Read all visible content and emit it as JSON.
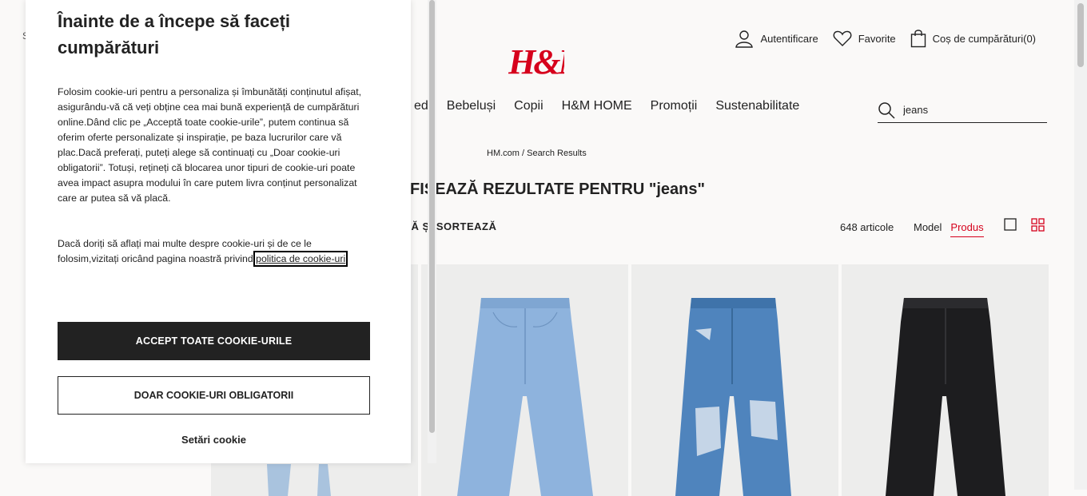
{
  "header": {
    "topleft_text": "S",
    "logo_text": "H&M",
    "login_label": "Autentificare",
    "favorites_label": "Favorite",
    "cart_label": "Coș de cumpărături(0)"
  },
  "nav": {
    "items": [
      {
        "label": "ed"
      },
      {
        "label": "Bebeluși"
      },
      {
        "label": "Copii"
      },
      {
        "label": "H&M HOME"
      },
      {
        "label": "Promoții"
      },
      {
        "label": "Sustenabilitate"
      }
    ]
  },
  "search": {
    "value": "jeans"
  },
  "breadcrumb": "HM.com / Search Results",
  "results": {
    "title": "FIȘEAZĂ REZULTATE PENTRU \"jeans\"",
    "filter_label": "ZĂ ȘI SORTEAZĂ",
    "count_label": "648 articole",
    "view_model": "Model",
    "view_product": "Produs"
  },
  "products": [
    {
      "name": "product-1",
      "color": "#a9c3de"
    },
    {
      "name": "product-2",
      "color": "#8eb3dd"
    },
    {
      "name": "product-3",
      "color": "#4f84bd"
    },
    {
      "name": "product-4",
      "color": "#1d1d1f"
    }
  ],
  "cookie": {
    "title": "Înainte de a începe să faceți cumpărături",
    "paragraph1": "Folosim cookie-uri pentru a personaliza și îmbunătăți conținutul afișat, asigurându-vă că veți obține cea mai bună experiență de cumpărături online.Dând clic pe „Acceptă toate cookie-urile”, putem continua să oferim oferte personalizate și inspirație, pe baza lucrurilor care vă plac.Dacă preferați, puteți alege să continuați cu „Doar cookie-uri obligatorii”. Totuși, rețineți că blocarea unor tipuri de cookie-uri poate avea impact asupra modului în care putem livra conținut personalizat care ar putea să vă placă.",
    "paragraph2_text": "Dacă doriți să aflați mai multe despre cookie-uri și de ce le folosim,vizitați oricând pagina noastră privind ",
    "policy_link": "politica de cookie-uri",
    "accept_button": "ACCEPT TOATE COOKIE-URILE",
    "required_button": "DOAR COOKIE-URI OBLIGATORII",
    "settings_link": "Setări cookie"
  },
  "colors": {
    "accent": "#d6001c",
    "dark": "#222222",
    "background": "#faf9f8"
  }
}
